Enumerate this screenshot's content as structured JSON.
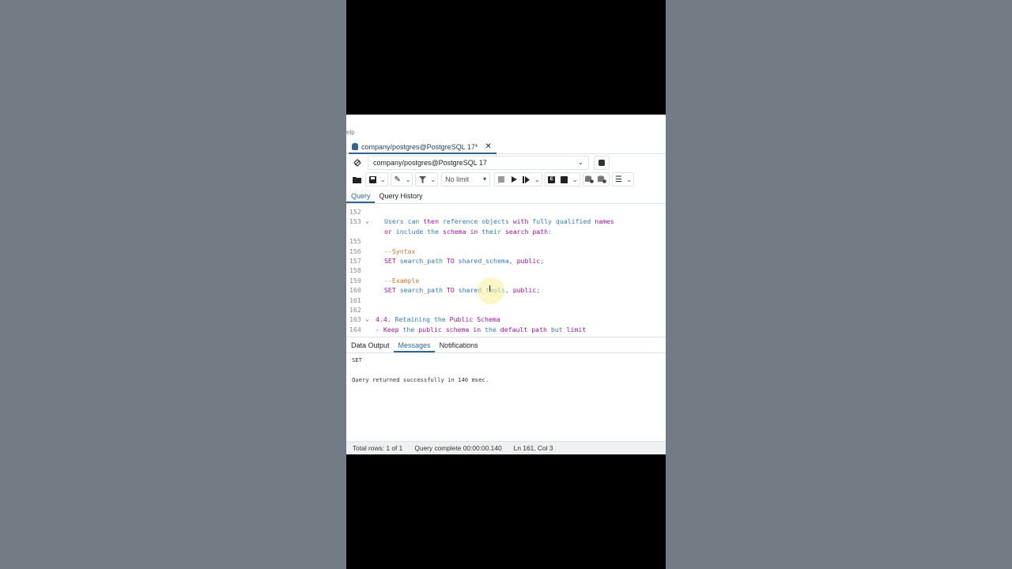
{
  "menu": {
    "help_label": "elp"
  },
  "doc_tab": {
    "label": "company/postgres@PostgreSQL 17*",
    "close": "✕"
  },
  "connection": {
    "label": "company/postgres@PostgreSQL 17"
  },
  "toolbar": {
    "limit_label": "No limit"
  },
  "editor_tabs": [
    {
      "label": "Query"
    },
    {
      "label": "Query History"
    }
  ],
  "code_lines": [
    {
      "ln": "152",
      "fold": "",
      "tokens": []
    },
    {
      "ln": "153",
      "fold": "v",
      "tokens": [
        {
          "t": "Users can ",
          "c": "id"
        },
        {
          "t": "then",
          "c": "kw"
        },
        {
          "t": " reference objects ",
          "c": "id"
        },
        {
          "t": "with",
          "c": "kw"
        },
        {
          "t": " fully qualified ",
          "c": "id"
        },
        {
          "t": "names",
          "c": "kw"
        }
      ]
    },
    {
      "ln": "",
      "fold": "",
      "tokens": [
        {
          "t": "or",
          "c": "kw"
        },
        {
          "t": " ",
          "c": "id"
        },
        {
          "t": "include",
          "c": "id"
        },
        {
          "t": " the ",
          "c": "id"
        },
        {
          "t": "schema",
          "c": "kw"
        },
        {
          "t": " ",
          "c": "id"
        },
        {
          "t": "in",
          "c": "kw"
        },
        {
          "t": " their ",
          "c": "id"
        },
        {
          "t": "search",
          "c": "kw"
        },
        {
          "t": " ",
          "c": "id"
        },
        {
          "t": "path",
          "c": "kw"
        },
        {
          "t": ":",
          "c": "id"
        }
      ]
    },
    {
      "ln": "155",
      "fold": "",
      "tokens": []
    },
    {
      "ln": "156",
      "fold": "",
      "tokens": [
        {
          "t": "--Syntax",
          "c": "cm"
        }
      ]
    },
    {
      "ln": "157",
      "fold": "",
      "tokens": [
        {
          "t": "SET",
          "c": "kw"
        },
        {
          "t": " search_path ",
          "c": "id"
        },
        {
          "t": "TO",
          "c": "kw"
        },
        {
          "t": " shared_schema, ",
          "c": "id"
        },
        {
          "t": "public",
          "c": "kw"
        },
        {
          "t": ";",
          "c": "id"
        }
      ]
    },
    {
      "ln": "158",
      "fold": "",
      "tokens": []
    },
    {
      "ln": "159",
      "fold": "",
      "tokens": [
        {
          "t": "--Example",
          "c": "cm"
        }
      ]
    },
    {
      "ln": "160",
      "fold": "",
      "tokens": [
        {
          "t": "SET",
          "c": "kw"
        },
        {
          "t": " search_path ",
          "c": "id"
        },
        {
          "t": "TO",
          "c": "kw"
        },
        {
          "t": " shared_tools, ",
          "c": "id"
        },
        {
          "t": "public",
          "c": "kw"
        },
        {
          "t": ";",
          "c": "id"
        }
      ]
    },
    {
      "ln": "161",
      "fold": "",
      "tokens": []
    },
    {
      "ln": "162",
      "fold": "",
      "tokens": []
    },
    {
      "ln": "163",
      "fold": "v",
      "outdent": true,
      "tokens": [
        {
          "t": "4.4. ",
          "c": "hd"
        },
        {
          "t": "Retaining the ",
          "c": "id"
        },
        {
          "t": "Public",
          "c": "kw"
        },
        {
          "t": " ",
          "c": "id"
        },
        {
          "t": "Schema",
          "c": "kw"
        }
      ]
    },
    {
      "ln": "164",
      "fold": "",
      "outdent": true,
      "tokens": [
        {
          "t": "- ",
          "c": "hd"
        },
        {
          "t": "Keep",
          "c": "kw"
        },
        {
          "t": " the ",
          "c": "id"
        },
        {
          "t": "public",
          "c": "kw"
        },
        {
          "t": " ",
          "c": "id"
        },
        {
          "t": "schema",
          "c": "kw"
        },
        {
          "t": " ",
          "c": "id"
        },
        {
          "t": "in",
          "c": "kw"
        },
        {
          "t": " the ",
          "c": "id"
        },
        {
          "t": "default",
          "c": "kw"
        },
        {
          "t": " ",
          "c": "id"
        },
        {
          "t": "path",
          "c": "kw"
        },
        {
          "t": " but ",
          "c": "id"
        },
        {
          "t": "limit",
          "c": "kw"
        }
      ]
    }
  ],
  "result_tabs": [
    {
      "label": "Data Output"
    },
    {
      "label": "Messages"
    },
    {
      "label": "Notifications"
    }
  ],
  "messages": {
    "line1": "SET",
    "line2": "Query returned successfully in 140 msec."
  },
  "status": {
    "rows": "Total rows: 1 of 1",
    "complete": "Query complete 00:00:00.140",
    "position": "Ln 161, Col 3"
  },
  "colors": {
    "accent": "#326690",
    "keyword": "#a0159a",
    "identifier": "#2f7fb4",
    "comment": "#c27b2a"
  }
}
